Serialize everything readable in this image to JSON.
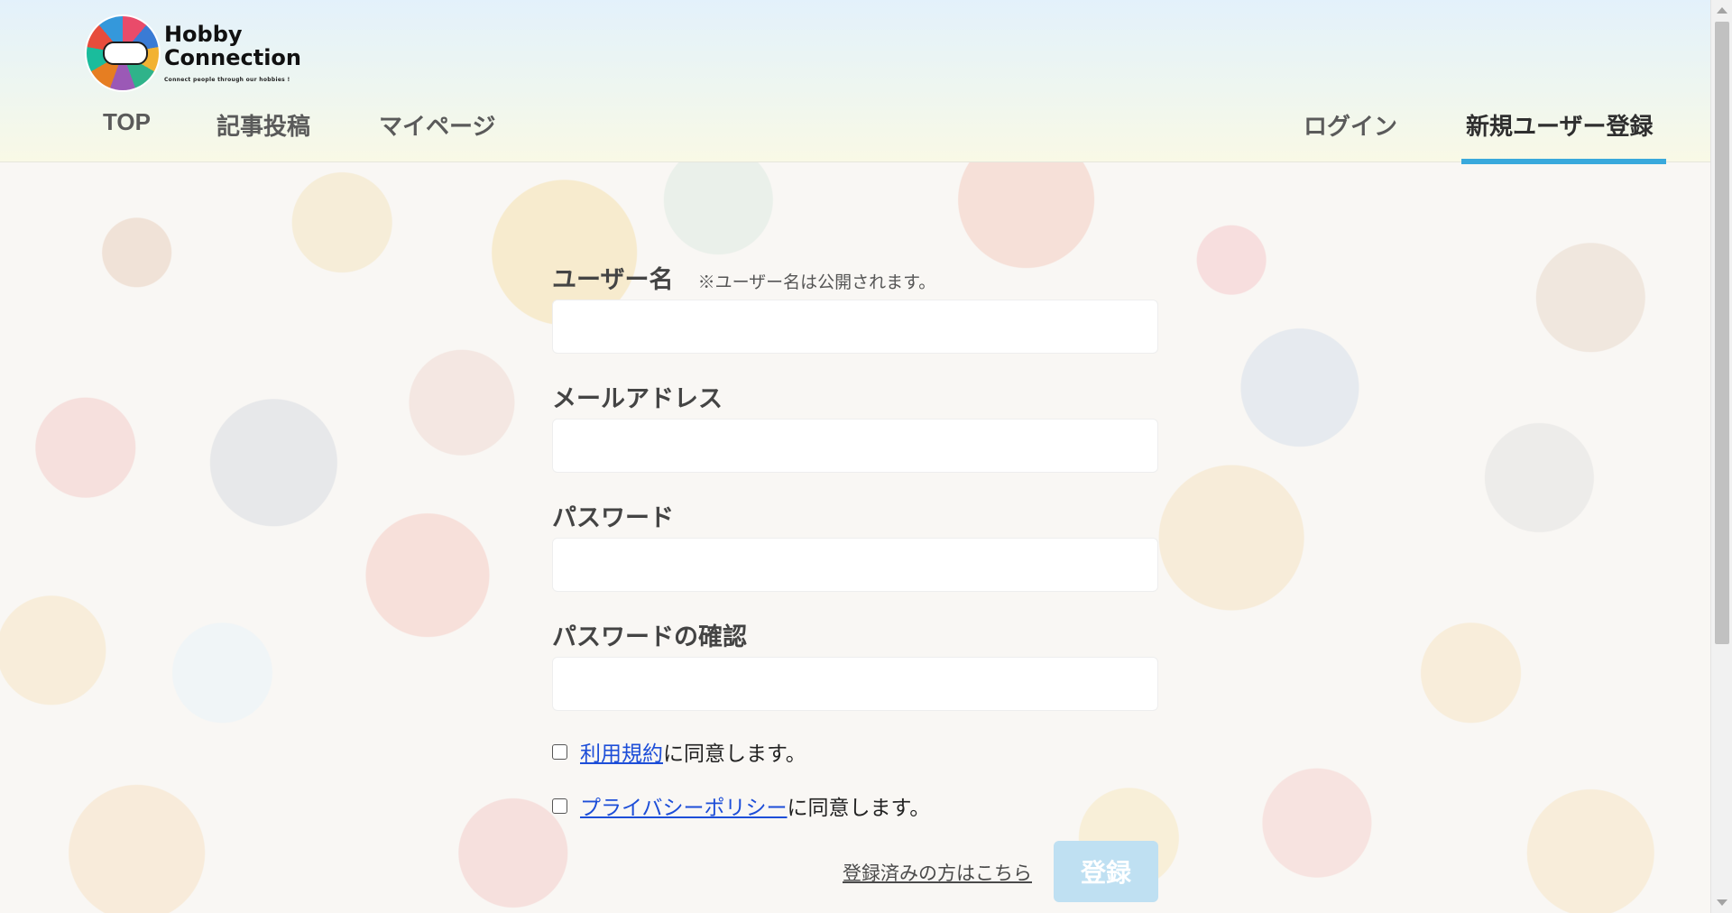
{
  "header": {
    "logo": {
      "line1": "Hobby",
      "line2": "Connection",
      "tagline": "Connect people through our hobbies !"
    },
    "nav": {
      "top": "TOP",
      "post": "記事投稿",
      "mypage": "マイページ",
      "login": "ログイン",
      "signup": "新規ユーザー登録"
    },
    "accent_color": "#39a9dc"
  },
  "form": {
    "username": {
      "label": "ユーザー名",
      "note": "※ユーザー名は公開されます。",
      "value": ""
    },
    "email": {
      "label": "メールアドレス",
      "value": ""
    },
    "password": {
      "label": "パスワード",
      "value": ""
    },
    "password_confirm": {
      "label": "パスワードの確認",
      "value": ""
    },
    "terms": {
      "link": "利用規約",
      "suffix": "に同意します。",
      "checked": false
    },
    "privacy": {
      "link": "プライバシーポリシー",
      "suffix": "に同意します。",
      "checked": false
    },
    "login_link": "登録済みの方はこちら",
    "submit_label": "登録"
  }
}
